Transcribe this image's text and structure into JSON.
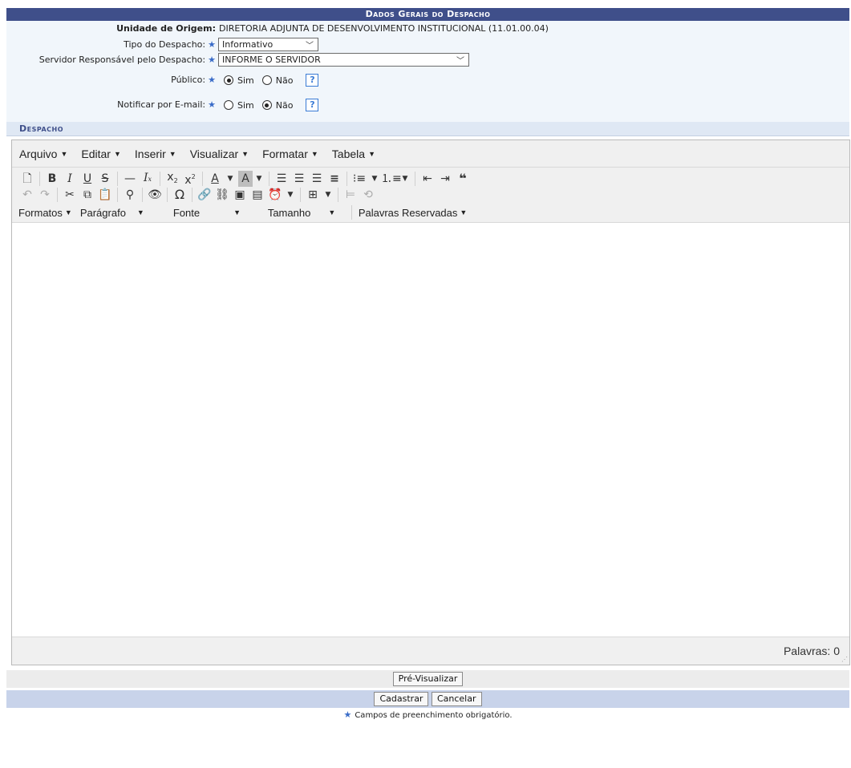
{
  "header": {
    "title": "Dados Gerais do Despacho"
  },
  "fields": {
    "unidade": {
      "label": "Unidade de Origem:",
      "value": "DIRETORIA ADJUNTA DE DESENVOLVIMENTO INSTITUCIONAL (11.01.00.04)"
    },
    "tipo": {
      "label": "Tipo do Despacho:",
      "value": "Informativo"
    },
    "servidor": {
      "label": "Servidor Responsável pelo Despacho:",
      "value": "INFORME O SERVIDOR"
    },
    "publico": {
      "label": "Público:",
      "opt_sim": "Sim",
      "opt_nao": "Não",
      "selected": "Sim",
      "help": "?"
    },
    "notificar": {
      "label": "Notificar por E-mail:",
      "opt_sim": "Sim",
      "opt_nao": "Não",
      "selected": "Não",
      "help": "?"
    },
    "required_mark": "★"
  },
  "section": {
    "title": "Despacho"
  },
  "editor": {
    "menus": [
      "Arquivo",
      "Editar",
      "Inserir",
      "Visualizar",
      "Formatar",
      "Tabela"
    ],
    "toolbar_row1": [
      "new-document",
      "bold",
      "italic",
      "underline",
      "strikethrough",
      "horizontal-rule",
      "clear-formatting",
      "subscript",
      "superscript",
      "text-color",
      "background-color",
      "align-left",
      "align-center",
      "align-right",
      "justify",
      "bullet-list",
      "numbered-list",
      "outdent",
      "indent",
      "blockquote"
    ],
    "toolbar_row2": [
      "undo",
      "redo",
      "cut",
      "copy",
      "paste",
      "find-replace",
      "preview",
      "special-character",
      "link",
      "unlink",
      "image",
      "media",
      "insert-datetime",
      "table",
      "page-break",
      "restore-draft"
    ],
    "format_menus": [
      "Formatos",
      "Parágrafo",
      "Fonte",
      "Tamanho",
      "Palavras Reservadas"
    ],
    "word_count": "Palavras: 0"
  },
  "buttons": {
    "preview": "Pré-Visualizar",
    "submit": "Cadastrar",
    "cancel": "Cancelar"
  },
  "footnote": "Campos de preenchimento obrigatório."
}
